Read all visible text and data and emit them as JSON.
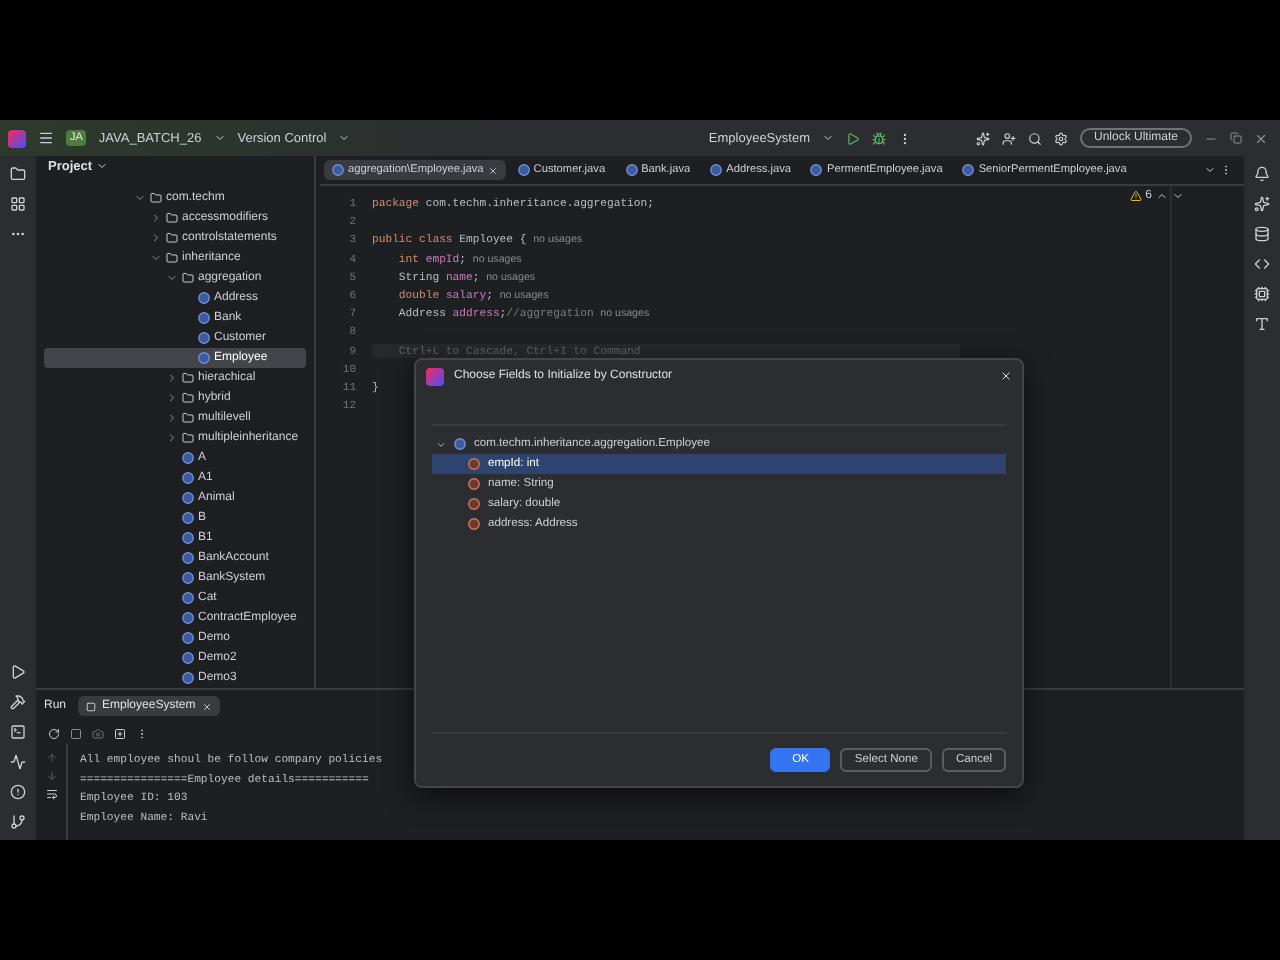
{
  "title_bar": {
    "project_badge": "JA",
    "project": "JAVA_BATCH_26",
    "vcs": "Version Control",
    "run_config": "EmployeeSystem",
    "unlock_button": "Unlock Ultimate"
  },
  "project_panel": {
    "title": "Project",
    "tree": [
      {
        "label": "com.techm",
        "kind": "package",
        "expanded": true,
        "selected": false,
        "children": [
          {
            "label": "accessmodifiers",
            "kind": "package",
            "expanded": false,
            "selected": false
          },
          {
            "label": "controlstatements",
            "kind": "package",
            "expanded": false,
            "selected": false
          },
          {
            "label": "inheritance",
            "kind": "package",
            "expanded": true,
            "selected": false,
            "children": [
              {
                "label": "aggregation",
                "kind": "package",
                "expanded": true,
                "selected": false,
                "children": [
                  {
                    "label": "Address",
                    "kind": "class",
                    "selected": false
                  },
                  {
                    "label": "Bank",
                    "kind": "class",
                    "selected": false
                  },
                  {
                    "label": "Customer",
                    "kind": "class",
                    "selected": false
                  },
                  {
                    "label": "Employee",
                    "kind": "class",
                    "selected": true
                  }
                ]
              },
              {
                "label": "hierachical",
                "kind": "package",
                "expanded": false,
                "selected": false
              },
              {
                "label": "hybrid",
                "kind": "package",
                "expanded": false,
                "selected": false
              },
              {
                "label": "multilevell",
                "kind": "package",
                "expanded": false,
                "selected": false
              },
              {
                "label": "multipleinheritance",
                "kind": "package",
                "expanded": false,
                "selected": false
              },
              {
                "label": "A",
                "kind": "class",
                "selected": false
              },
              {
                "label": "A1",
                "kind": "class",
                "selected": false
              },
              {
                "label": "Animal",
                "kind": "class",
                "selected": false
              },
              {
                "label": "B",
                "kind": "class",
                "selected": false
              },
              {
                "label": "B1",
                "kind": "class",
                "selected": false
              },
              {
                "label": "BankAccount",
                "kind": "class",
                "selected": false
              },
              {
                "label": "BankSystem",
                "kind": "class",
                "selected": false
              },
              {
                "label": "Cat",
                "kind": "class",
                "selected": false
              },
              {
                "label": "ContractEmployee",
                "kind": "class",
                "selected": false
              },
              {
                "label": "Demo",
                "kind": "class",
                "selected": false
              },
              {
                "label": "Demo2",
                "kind": "class",
                "selected": false
              },
              {
                "label": "Demo3",
                "kind": "class",
                "selected": false
              }
            ]
          }
        ]
      }
    ]
  },
  "editor": {
    "tabs": [
      {
        "label": "aggregation\\Employee.java",
        "selected": true
      },
      {
        "label": "Customer.java",
        "selected": false
      },
      {
        "label": "Bank.java",
        "selected": false
      },
      {
        "label": "Address.java",
        "selected": false
      },
      {
        "label": "PermentEmployee.java",
        "selected": false
      },
      {
        "label": "SeniorPermentEmployee.java",
        "selected": false
      }
    ],
    "warnings": "6",
    "lines": [
      {
        "number": "1",
        "segments": [
          {
            "text": "package",
            "kind": "keyword"
          },
          {
            "text": " com.techm.inheritance.aggregation;",
            "kind": "plain"
          }
        ]
      },
      {
        "number": "2"
      },
      {
        "number": "3",
        "segments": [
          {
            "text": "public class",
            "kind": "keyword"
          },
          {
            "text": " Employee { ",
            "kind": "plain"
          },
          {
            "text": "no usages",
            "kind": "hint"
          }
        ]
      },
      {
        "number": "4",
        "segments": [
          {
            "text": "    int ",
            "kind": "keyword"
          },
          {
            "text": "empId",
            "kind": "field"
          },
          {
            "text": "; ",
            "kind": "plain"
          },
          {
            "text": "no usages",
            "kind": "hint"
          }
        ]
      },
      {
        "number": "5",
        "segments": [
          {
            "text": "    String ",
            "kind": "plain"
          },
          {
            "text": "name",
            "kind": "field"
          },
          {
            "text": "; ",
            "kind": "plain"
          },
          {
            "text": "no usages",
            "kind": "hint"
          }
        ]
      },
      {
        "number": "6",
        "segments": [
          {
            "text": "    double ",
            "kind": "keyword"
          },
          {
            "text": "salary",
            "kind": "field"
          },
          {
            "text": "; ",
            "kind": "plain"
          },
          {
            "text": "no usages",
            "kind": "hint"
          }
        ]
      },
      {
        "number": "7",
        "segments": [
          {
            "text": "    Address ",
            "kind": "plain"
          },
          {
            "text": "address",
            "kind": "field"
          },
          {
            "text": ";",
            "kind": "plain"
          },
          {
            "text": "//aggregation ",
            "kind": "comment"
          },
          {
            "text": "no usages",
            "kind": "hint"
          }
        ]
      },
      {
        "number": "8"
      },
      {
        "number": "9",
        "segments": [
          {
            "text": "    Ctrl+L to Cascade, Ctrl+I to Command",
            "kind": "prompt"
          }
        ]
      },
      {
        "number": "10"
      },
      {
        "number": "11",
        "segments": [
          {
            "text": "}",
            "kind": "plain"
          }
        ]
      },
      {
        "number": "12"
      }
    ]
  },
  "run_panel": {
    "title": "Run",
    "tab": "EmployeeSystem",
    "console": [
      "All employee shoul be follow company policies",
      "================Employee details===========",
      "Employee ID: 103",
      "Employee Name: Ravi"
    ]
  },
  "dialog": {
    "title": "Choose Fields to Initialize by Constructor",
    "root": {
      "label": "com.techm.inheritance.aggregation.Employee",
      "expanded": true
    },
    "fields": [
      {
        "label": "empId: int",
        "selected": true
      },
      {
        "label": "name: String",
        "selected": false
      },
      {
        "label": "salary: double",
        "selected": false
      },
      {
        "label": "address: Address",
        "selected": false
      }
    ],
    "buttons": [
      {
        "label": "OK",
        "kind": "primary"
      },
      {
        "label": "Select None",
        "kind": "secondary"
      },
      {
        "label": "Cancel",
        "kind": "secondary"
      }
    ]
  }
}
